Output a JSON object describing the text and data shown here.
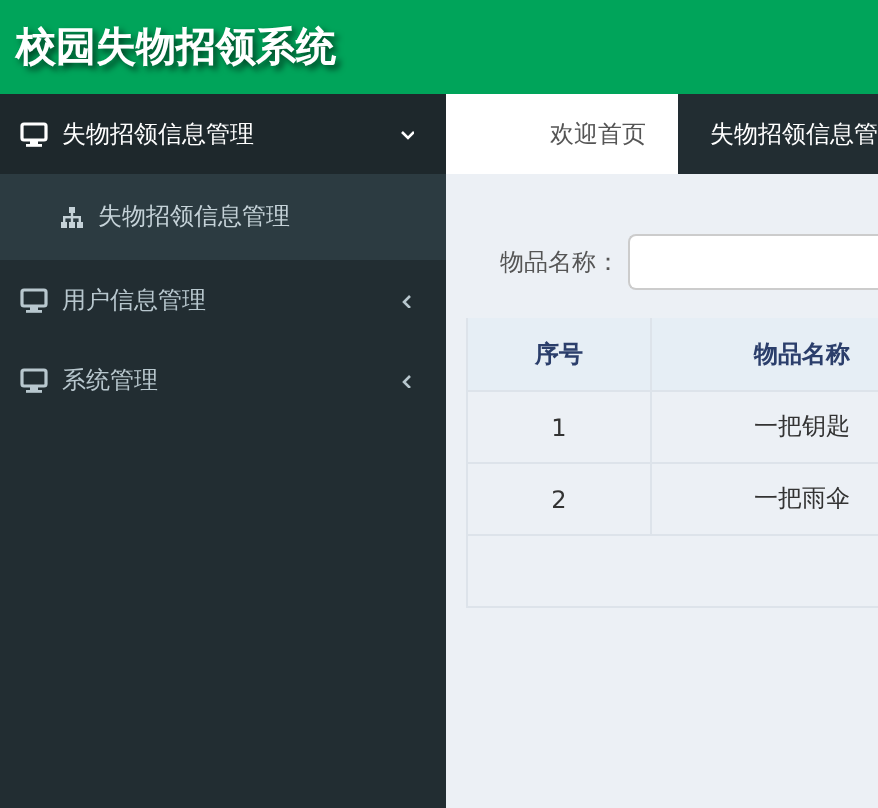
{
  "header": {
    "title": "校园失物招领系统"
  },
  "sidebar": {
    "items": [
      {
        "label": "失物招领信息管理",
        "expanded": true,
        "children": [
          {
            "label": "失物招领信息管理"
          }
        ]
      },
      {
        "label": "用户信息管理",
        "expanded": false
      },
      {
        "label": "系统管理",
        "expanded": false
      }
    ]
  },
  "tabs": [
    {
      "label": "欢迎首页",
      "selected": false
    },
    {
      "label": "失物招领信息管",
      "selected": true
    }
  ],
  "search": {
    "label": "物品名称："
  },
  "table": {
    "columns": [
      "序号",
      "物品名称"
    ],
    "rows": [
      [
        "1",
        "一把钥匙"
      ],
      [
        "2",
        "一把雨伞"
      ]
    ]
  }
}
